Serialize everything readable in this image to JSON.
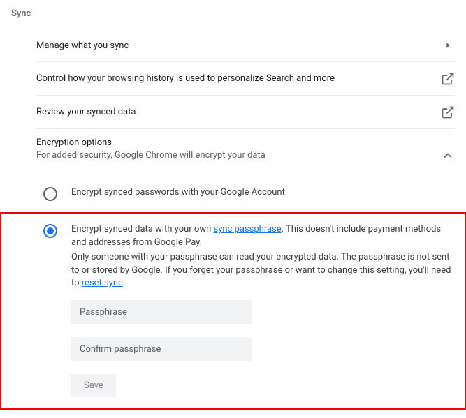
{
  "section_title": "Sync",
  "rows": {
    "manage": "Manage what you sync",
    "personalize": "Control how your browsing history is used to personalize Search and more",
    "review": "Review your synced data"
  },
  "encryption": {
    "title": "Encryption options",
    "subtitle": "For added security, Google Chrome will encrypt your data",
    "option1": "Encrypt synced passwords with your Google Account",
    "option2_prefix": "Encrypt synced data with your own ",
    "option2_link1": "sync passphrase",
    "option2_suffix": ". This doesn't include payment methods and addresses from Google Pay.",
    "option2_desc_prefix": "Only someone with your passphrase can read your encrypted data. The passphrase is not sent to or stored by Google. If you forget your passphrase or want to change this setting, you'll need to ",
    "option2_link2": "reset sync",
    "option2_desc_suffix": ".",
    "passphrase_placeholder": "Passphrase",
    "confirm_placeholder": "Confirm passphrase",
    "save_label": "Save"
  }
}
